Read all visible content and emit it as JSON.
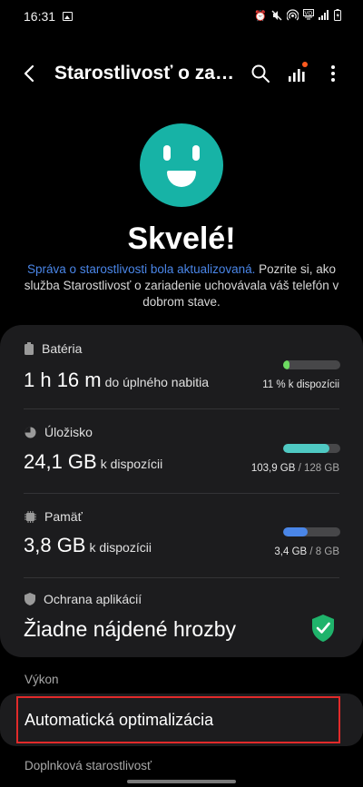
{
  "status_bar": {
    "time": "16:31",
    "left_icons": [
      "image-icon"
    ],
    "right_icons": [
      "alarm-icon",
      "mute-icon",
      "hotspot-icon",
      "volte-icon",
      "signal-icon",
      "battery-icon"
    ]
  },
  "app_bar": {
    "title": "Starostlivosť o zaria…",
    "back_icon": "back-arrow-icon",
    "actions": [
      "search-icon",
      "signal-stats-icon",
      "more-options-icon"
    ]
  },
  "hero": {
    "face_color": "#17b3a6",
    "headline": "Skvelé!",
    "desc_link": "Správa o starostlivosti bola aktualizovaná.",
    "desc_text": " Pozrite si, ako služba Starostlivosť o zariadenie uchovávala váš telefón v dobrom stave."
  },
  "items": {
    "battery": {
      "label": "Batéria",
      "big": "1 h 16 m",
      "small": "do úplného nabitia",
      "caption": "11 % k dispozícii",
      "fill": 0.11,
      "color": "#6ddb61"
    },
    "storage": {
      "label": "Úložisko",
      "big": "24,1 GB",
      "small": "k dispozícii",
      "caption_main": "103,9 GB",
      "caption_muted": " / 128 GB",
      "fill": 0.81,
      "color": "#4fc9c3"
    },
    "memory": {
      "label": "Pamäť",
      "big": "3,8 GB",
      "small": "k dispozícii",
      "caption_main": "3,4 GB",
      "caption_muted": " / 8 GB",
      "fill": 0.43,
      "color": "#4a86e8"
    },
    "protection": {
      "label": "Ochrana aplikácií",
      "big": "Žiadne nájdené hrozby",
      "status_color": "#1fb36b"
    }
  },
  "sections": {
    "performance_label": "Výkon",
    "auto_optimization": "Automatická optimalizácia",
    "extra_label": "Doplnková starostlivosť"
  },
  "colors": {
    "link": "#4a86e8",
    "card_bg": "#1c1c1e",
    "highlight": "#e12a2a"
  }
}
